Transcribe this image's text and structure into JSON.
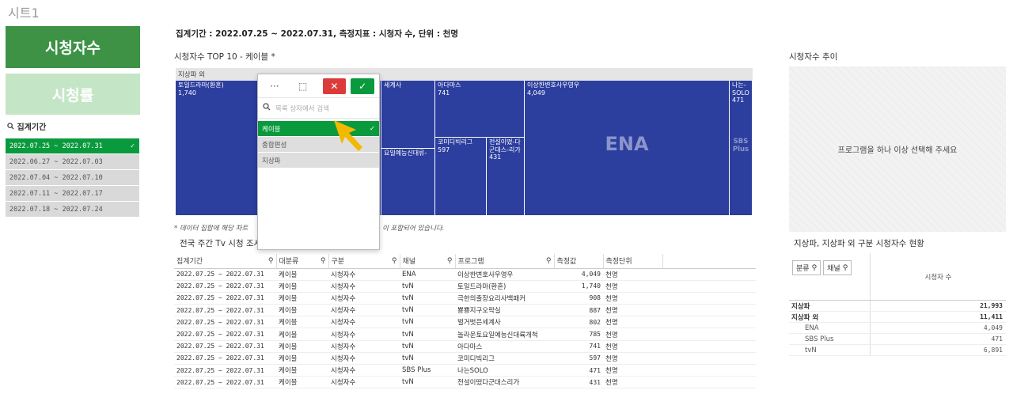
{
  "sheet_title": "시트1",
  "nav": {
    "active": "시청자수",
    "inactive": "시청률"
  },
  "period_filter": {
    "label": "집계기간",
    "items": [
      {
        "label": "2022.07.25 ~ 2022.07.31",
        "selected": true
      },
      {
        "label": "2022.06.27 ~ 2022.07.03",
        "selected": false
      },
      {
        "label": "2022.07.04 ~ 2022.07.10",
        "selected": false
      },
      {
        "label": "2022.07.11 ~ 2022.07.17",
        "selected": false
      },
      {
        "label": "2022.07.18 ~ 2022.07.24",
        "selected": false
      }
    ]
  },
  "header": "집계기간 : 2022.07.25 ~ 2022.07.31, 측정지표 : 시청자 수, 단위 : 천명",
  "treemap": {
    "title": "시청자수 TOP 10 - 케이블 *",
    "group_label": "지상파 외",
    "cells": [
      {
        "label": "토일드라마(환혼)",
        "value": "1,740"
      },
      {
        "label": "세계사",
        "value": ""
      },
      {
        "label": "요일예능신대류-",
        "value": ""
      },
      {
        "label": "아다마스",
        "value": "741"
      },
      {
        "label": "코미디빅리그",
        "value": "597"
      },
      {
        "label": "전설이떴-다군대스-리가",
        "value": "431"
      },
      {
        "label": "이상한변호사우영우",
        "value": "4,049"
      },
      {
        "label": "나는-SOLO",
        "value": "471"
      }
    ],
    "big_labels": {
      "ena": "ENA",
      "sbs": "SBS Plus"
    }
  },
  "note": "* 데이터 집합에 해당 차트 ... 이 포함되어 있습니다.",
  "note_left": "* 데이터 집합에 해당 차트",
  "note_right": "이 포함되어 있습니다.",
  "table_title": "전국 주간 Tv 시청 조사",
  "table": {
    "headers": [
      "집계기간",
      "대분류",
      "구분",
      "채널",
      "프로그램",
      "측정값",
      "측정단위"
    ],
    "rows": [
      [
        "2022.07.25 ~ 2022.07.31",
        "케이블",
        "시청자수",
        "ENA",
        "이상한변호사우영우",
        "4,049",
        "천명"
      ],
      [
        "2022.07.25 ~ 2022.07.31",
        "케이블",
        "시청자수",
        "tvN",
        "토일드라마(환혼)",
        "1,740",
        "천명"
      ],
      [
        "2022.07.25 ~ 2022.07.31",
        "케이블",
        "시청자수",
        "tvN",
        "극한의출장요리사백패커",
        "908",
        "천명"
      ],
      [
        "2022.07.25 ~ 2022.07.31",
        "케이블",
        "시청자수",
        "tvN",
        "뿅뿅지구오락실",
        "887",
        "천명"
      ],
      [
        "2022.07.25 ~ 2022.07.31",
        "케이블",
        "시청자수",
        "tvN",
        "벌거벗은세계사",
        "802",
        "천명"
      ],
      [
        "2022.07.25 ~ 2022.07.31",
        "케이블",
        "시청자수",
        "tvN",
        "놀라운토요일예능신대륙개척",
        "785",
        "천명"
      ],
      [
        "2022.07.25 ~ 2022.07.31",
        "케이블",
        "시청자수",
        "tvN",
        "아다마스",
        "741",
        "천명"
      ],
      [
        "2022.07.25 ~ 2022.07.31",
        "케이블",
        "시청자수",
        "tvN",
        "코미디빅리그",
        "597",
        "천명"
      ],
      [
        "2022.07.25 ~ 2022.07.31",
        "케이블",
        "시청자수",
        "SBS Plus",
        "나는SOLO",
        "471",
        "천명"
      ],
      [
        "2022.07.25 ~ 2022.07.31",
        "케이블",
        "시청자수",
        "tvN",
        "전설이떴다군대스리가",
        "431",
        "천명"
      ]
    ]
  },
  "trend": {
    "title": "시청자수 추이",
    "placeholder": "프로그램을 하나 이상 선택해 주세요"
  },
  "pivot": {
    "title": "지상파, 지상파 외 구분 시청자수 현황",
    "btn_category": "분류",
    "btn_channel": "채널",
    "col_header": "시청자 수",
    "rows": [
      {
        "label": "지상파",
        "value": "21,993",
        "bold": true,
        "indent": false
      },
      {
        "label": "지상파 외",
        "value": "11,411",
        "bold": true,
        "indent": false
      },
      {
        "label": "ENA",
        "value": "4,049",
        "bold": false,
        "indent": true
      },
      {
        "label": "SBS Plus",
        "value": "471",
        "bold": false,
        "indent": true
      },
      {
        "label": "tvN",
        "value": "6,891",
        "bold": false,
        "indent": true
      }
    ]
  },
  "popup": {
    "search_placeholder": "목록 상자에서 검색",
    "items": [
      {
        "label": "케이블",
        "state": "selected"
      },
      {
        "label": "종합편성",
        "state": "alternative"
      },
      {
        "label": "지상파",
        "state": "alternative"
      }
    ],
    "more_label": "···"
  },
  "colors": {
    "accent": "#3d9245",
    "selected": "#0a9a3e",
    "treemap": "#2c3e9e",
    "cancel": "#dc3b3b",
    "pointer": "#f5b800"
  }
}
